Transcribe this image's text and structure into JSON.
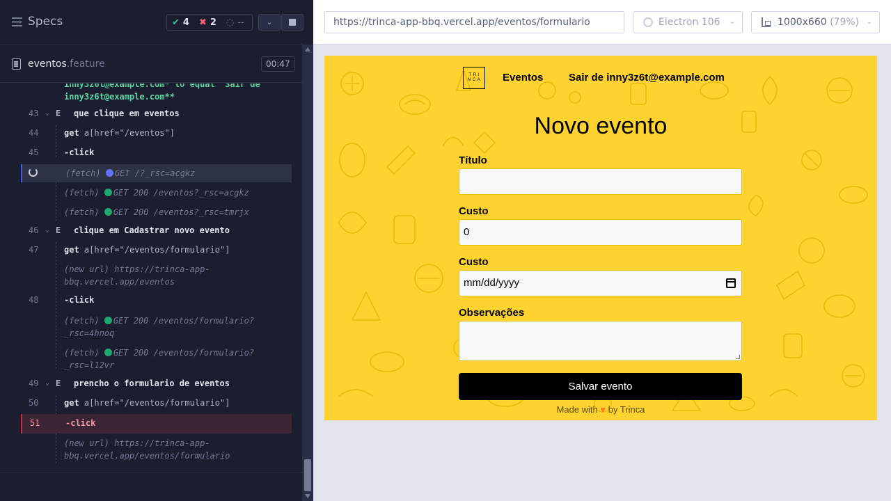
{
  "runner": {
    "specs_label": "Specs",
    "stats": {
      "passed": "4",
      "failed": "2",
      "pending": "--"
    },
    "file": {
      "name": "eventos",
      "ext": ".feature",
      "duration": "00:47"
    },
    "log_top_continuation": [
      "inny3z6t@example.com* to equal \"Sair de",
      "inny3z6t@example.com**"
    ],
    "log": [
      {
        "line": "43",
        "type": "step",
        "keyword": "E",
        "text": "que clique em eventos"
      },
      {
        "line": "44",
        "type": "cmd",
        "cmd": "get",
        "arg": "a[href=\"/eventos\"]"
      },
      {
        "line": "45",
        "type": "cmd",
        "cmd": "-click",
        "arg": ""
      },
      {
        "type": "fetch",
        "label": "(fetch)",
        "text": "GET /?_rsc=acgkz",
        "status": "pending"
      },
      {
        "type": "fetch",
        "label": "(fetch)",
        "text": "GET 200 /eventos?_rsc=acgkz",
        "status": "ok"
      },
      {
        "type": "fetch",
        "label": "(fetch)",
        "text": "GET 200 /eventos?_rsc=tmrjx",
        "status": "ok"
      },
      {
        "line": "46",
        "type": "step",
        "keyword": "E",
        "text": "clique em Cadastrar novo evento"
      },
      {
        "line": "47",
        "type": "cmd",
        "cmd": "get",
        "arg": "a[href=\"/eventos/formulario\"]"
      },
      {
        "type": "newurl",
        "label": "(new url)",
        "text1": "https://trinca-app-",
        "text2": "bbq.vercel.app/eventos"
      },
      {
        "line": "48",
        "type": "cmd",
        "cmd": "-click",
        "arg": ""
      },
      {
        "type": "fetch2",
        "label": "(fetch)",
        "text1": "GET 200 /eventos/formulario?",
        "text2": "_rsc=4hnoq",
        "status": "ok"
      },
      {
        "type": "fetch2",
        "label": "(fetch)",
        "text1": "GET 200 /eventos/formulario?",
        "text2": "_rsc=l12vr",
        "status": "ok"
      },
      {
        "line": "49",
        "type": "step",
        "keyword": "E",
        "text": "prencho o formulario de eventos"
      },
      {
        "line": "50",
        "type": "cmd",
        "cmd": "get",
        "arg": "a[href=\"/eventos/formulario\"]"
      },
      {
        "line": "51",
        "type": "cmd",
        "cmd": "-click",
        "arg": "",
        "failed": true
      },
      {
        "type": "newurl",
        "label": "(new url)",
        "text1": "https://trinca-app-",
        "text2": "bbq.vercel.app/eventos/formulario"
      }
    ]
  },
  "aut": {
    "url": "https://trinca-app-bbq.vercel.app/eventos/formulario",
    "browser": "Electron 106",
    "viewport": "1000x660",
    "viewport_pct": "(79%)"
  },
  "app": {
    "logo_line1": "TRI",
    "logo_line2": "NCA",
    "nav_eventos": "Eventos",
    "nav_sair": "Sair de inny3z6t@example.com",
    "title": "Novo evento",
    "labels": {
      "titulo": "Título",
      "custo": "Custo",
      "data": "Custo",
      "obs": "Observações"
    },
    "values": {
      "titulo": "",
      "custo": "0",
      "data": "mm/dd/yyyy",
      "obs": ""
    },
    "submit": "Salvar evento",
    "footer_pre": "Made with",
    "footer_heart": "♥",
    "footer_post": "by Trinca"
  },
  "colors": {
    "accent": "#fed330",
    "pass": "#3ab88c",
    "fail": "#f25f74",
    "pending": "#6470f3"
  }
}
